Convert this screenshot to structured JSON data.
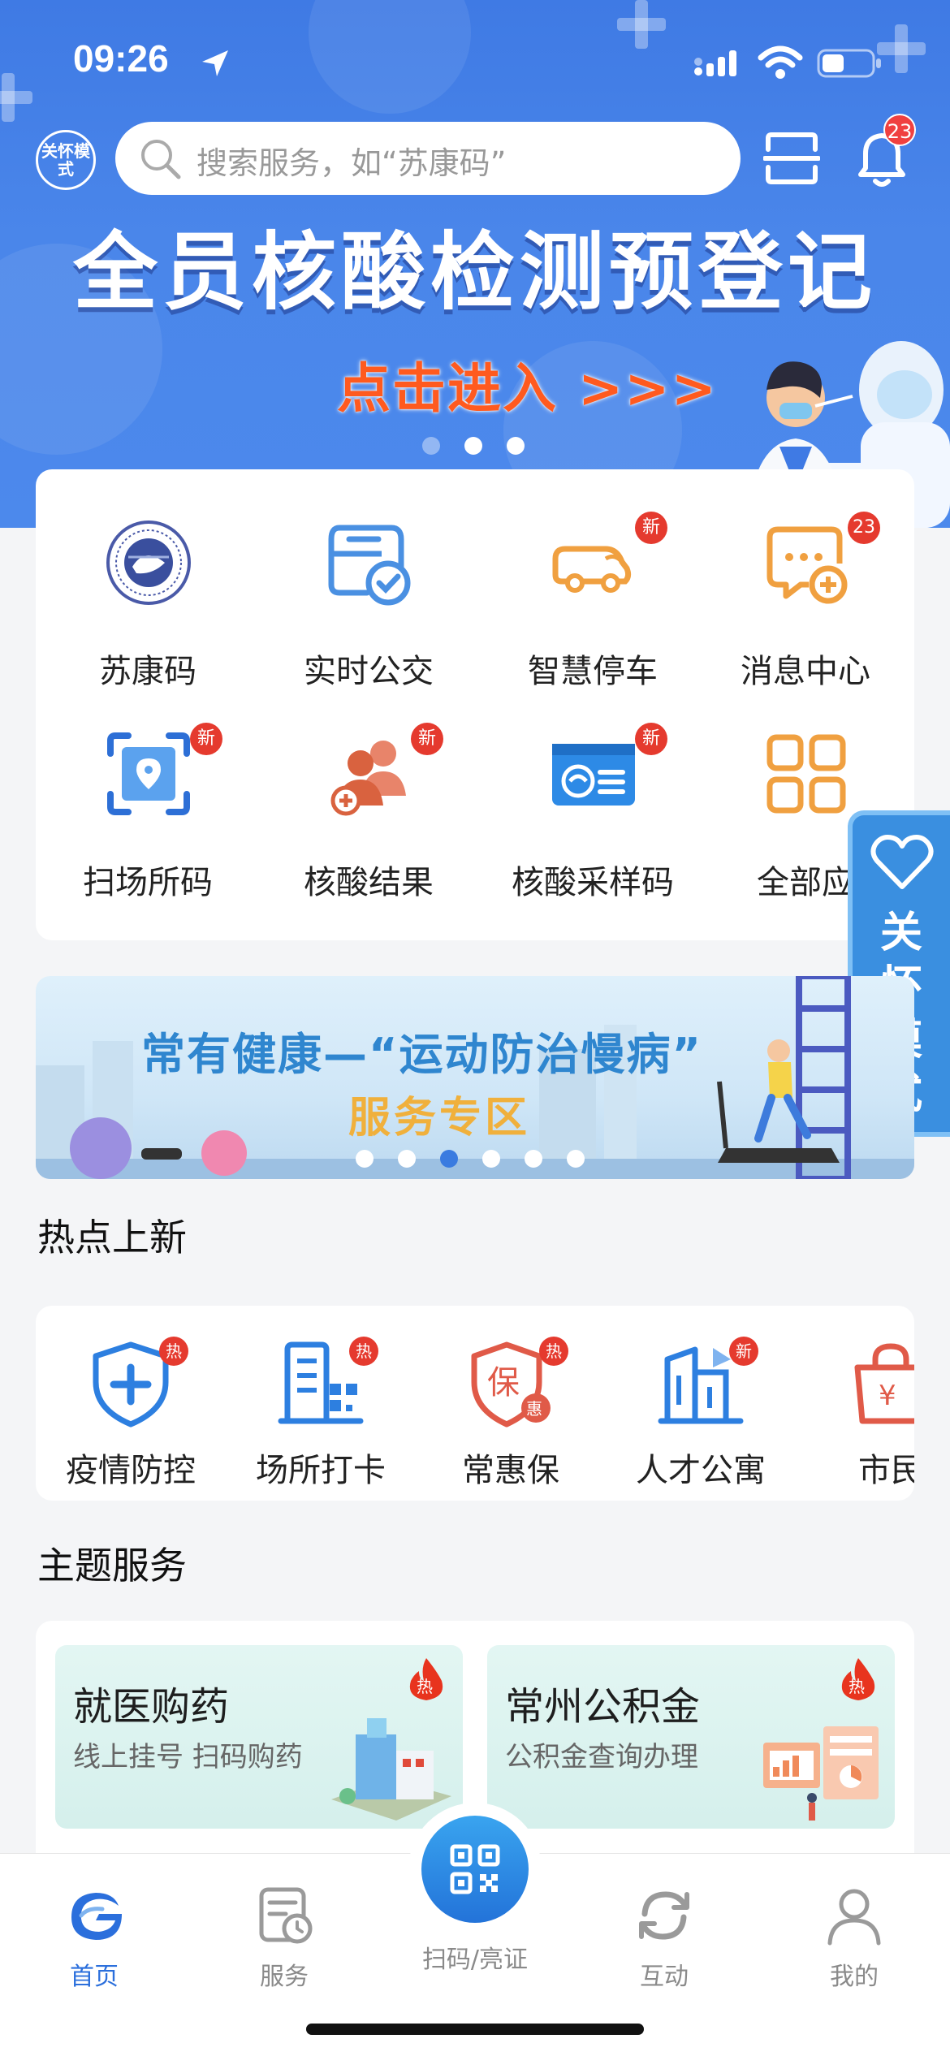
{
  "status_bar": {
    "time": "09:26"
  },
  "header": {
    "care_mode_badge": "关怀模式",
    "search_placeholder": "搜索服务，如“苏康码”",
    "notification_count": "23"
  },
  "hero_banner": {
    "title": "全员核酸检测预登记",
    "cta": "点击进入 >>>",
    "page_count": 3,
    "active_page": 2
  },
  "quick_grid": [
    {
      "label": "苏康码",
      "icon": "sukang-emblem-icon",
      "badge": ""
    },
    {
      "label": "实时公交",
      "icon": "bus-check-icon",
      "badge": ""
    },
    {
      "label": "智慧停车",
      "icon": "car-icon",
      "badge": "新"
    },
    {
      "label": "消息中心",
      "icon": "message-plus-icon",
      "badge": "23"
    },
    {
      "label": "扫场所码",
      "icon": "scan-location-icon",
      "badge": "新"
    },
    {
      "label": "核酸结果",
      "icon": "people-add-icon",
      "badge": "新"
    },
    {
      "label": "核酸采样码",
      "icon": "id-card-icon",
      "badge": "新"
    },
    {
      "label": "全部应",
      "icon": "grid-apps-icon",
      "badge": ""
    }
  ],
  "care_tab": {
    "label": "关怀模式"
  },
  "promo_banner": {
    "title": "常有健康—“运动防治慢病”",
    "subtitle": "服务专区",
    "page_count": 6,
    "active_page": 3
  },
  "hot_section": {
    "title": "热点上新",
    "items": [
      {
        "label": "疫情防控",
        "icon": "shield-plus-icon",
        "badge": "热"
      },
      {
        "label": "场所打卡",
        "icon": "building-qr-icon",
        "badge": "热"
      },
      {
        "label": "常惠保",
        "icon": "insurance-shield-icon",
        "badge": "热"
      },
      {
        "label": "人才公寓",
        "icon": "apartment-icon",
        "badge": "新"
      },
      {
        "label": "市民",
        "icon": "shopping-bag-icon",
        "badge": ""
      }
    ]
  },
  "theme_section": {
    "title": "主题服务",
    "cards": [
      {
        "title": "就医购药",
        "subtitle": "线上挂号 扫码购药",
        "badge": "热"
      },
      {
        "title": "常州公积金",
        "subtitle": "公积金查询办理",
        "badge": "热"
      }
    ]
  },
  "tab_bar": {
    "tabs": [
      {
        "label": "首页",
        "icon": "home-logo-icon",
        "active": true
      },
      {
        "label": "服务",
        "icon": "service-doc-icon",
        "active": false
      },
      {
        "label": "扫码/亮证",
        "icon": "qr-scan-icon",
        "active": false
      },
      {
        "label": "互动",
        "icon": "refresh-icon",
        "active": false
      },
      {
        "label": "我的",
        "icon": "user-icon",
        "active": false
      }
    ]
  },
  "colors": {
    "primary_blue": "#4a86ea",
    "badge_red": "#e53a2e",
    "orange": "#ff5a1f",
    "active_tab": "#2b6fdc"
  }
}
